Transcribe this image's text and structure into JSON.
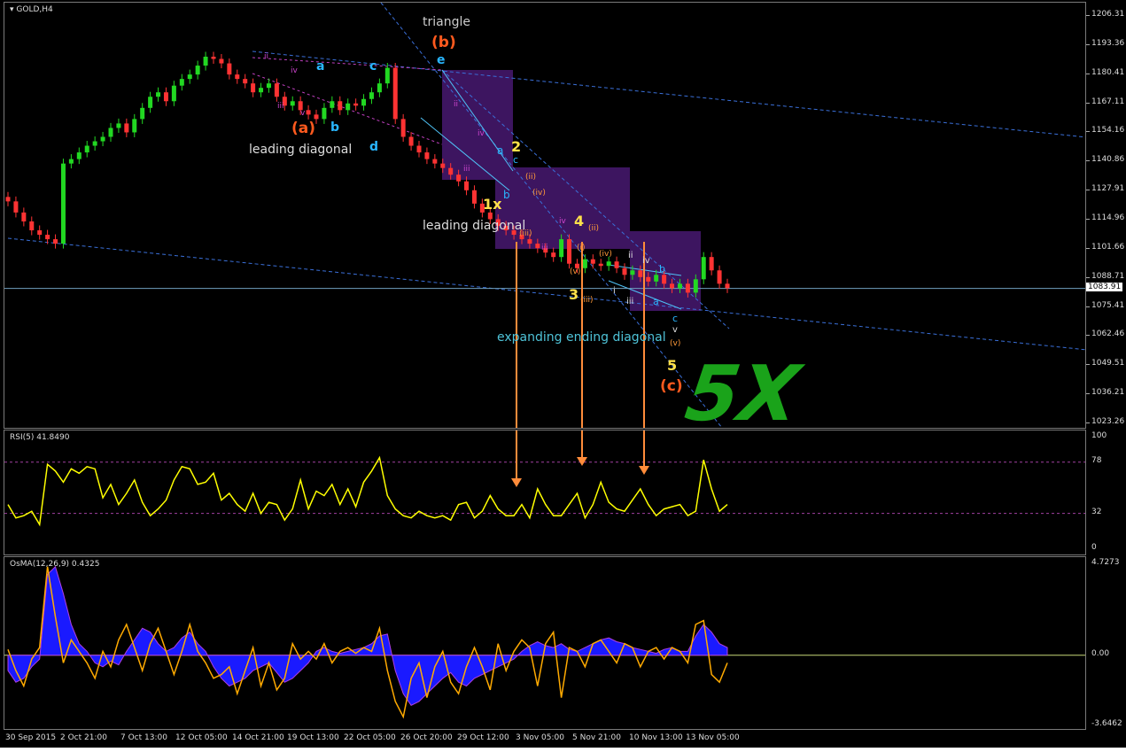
{
  "window": {
    "main_title": "GOLD,H4",
    "rsi_title": "RSI(5) 41.8490",
    "osma_title": "OsMA(12,26,9) 0.4325"
  },
  "colors": {
    "bull": "#22d822",
    "bear": "#ff3333",
    "rsi": "#ffff00",
    "osma_fill": "#1a1aff",
    "signal": "#ffaa00",
    "guide": "#3a6fd8",
    "box": "#3d1560",
    "arrow": "#ff8c3a"
  },
  "price_axis": {
    "ticks": [
      "1206.31",
      "1193.36",
      "1180.41",
      "1167.11",
      "1154.16",
      "1140.86",
      "1127.91",
      "1114.96",
      "1101.66",
      "1088.71",
      "1075.41",
      "1062.46",
      "1049.51",
      "1036.21",
      "1023.26"
    ],
    "current": "1083.91"
  },
  "rsi_axis": {
    "ticks": [
      "100",
      "78",
      "32",
      "0"
    ]
  },
  "osma_axis": {
    "ticks": [
      "4.7273",
      "0.00",
      "-3.6462"
    ]
  },
  "time_axis": [
    "30 Sep 2015",
    "2 Oct 21:00",
    "7 Oct 13:00",
    "12 Oct 05:00",
    "14 Oct 21:00",
    "19 Oct 13:00",
    "22 Oct 05:00",
    "26 Oct 20:00",
    "29 Oct 12:00",
    "3 Nov 05:00",
    "5 Nov 21:00",
    "10 Nov 13:00",
    "13 Nov 05:00"
  ],
  "annotations": {
    "triangle": "triangle",
    "b_wave": "(b)",
    "e": "e",
    "a_wave": "(a)",
    "c_wave": "(c)",
    "leading_diag_1": "leading diagonal",
    "leading_diag_2": "leading diagonal",
    "expanding_diag": "expanding ending diagonal",
    "a": "a",
    "b": "b",
    "c": "c",
    "d": "d",
    "w1x": "1x",
    "w2": "2",
    "w3": "3",
    "w4": "4",
    "w5": "5",
    "big_5x": "5X",
    "small": {
      "ii": "ii",
      "iv": "iv",
      "i": "i",
      "iii": "iii",
      "v": "v",
      "p_ii": "(ii)",
      "p_iii": "(iii)",
      "p_iv": "(iv)",
      "p_v": "(v)",
      "p_i": "(i)"
    }
  },
  "chart_data": [
    {
      "type": "candlestick",
      "title": "GOLD,H4",
      "ylim": [
        1023.26,
        1206.31
      ],
      "x": [
        "30 Sep 2015",
        "2 Oct 21:00",
        "7 Oct 13:00",
        "12 Oct 05:00",
        "14 Oct 21:00",
        "19 Oct 13:00",
        "22 Oct 05:00",
        "26 Oct 20:00",
        "29 Oct 12:00",
        "3 Nov 05:00",
        "5 Nov 21:00",
        "10 Nov 13:00",
        "13 Nov 05:00"
      ],
      "close_path": [
        1123,
        1118,
        1114,
        1110,
        1108,
        1106,
        1104,
        1140,
        1142,
        1145,
        1148,
        1150,
        1152,
        1156,
        1158,
        1154,
        1160,
        1165,
        1170,
        1172,
        1168,
        1175,
        1178,
        1180,
        1184,
        1188,
        1187,
        1185,
        1180,
        1178,
        1176,
        1172,
        1174,
        1176,
        1170,
        1166,
        1168,
        1164,
        1162,
        1160,
        1165,
        1168,
        1164,
        1167,
        1166,
        1169,
        1172,
        1176,
        1183,
        1160,
        1152,
        1148,
        1145,
        1142,
        1140,
        1138,
        1135,
        1132,
        1128,
        1122,
        1118,
        1115,
        1112,
        1110,
        1108,
        1106,
        1104,
        1102,
        1100,
        1098,
        1106,
        1095,
        1093,
        1097,
        1095,
        1094,
        1096,
        1093,
        1090,
        1092,
        1089,
        1087,
        1090,
        1086,
        1084,
        1086,
        1082,
        1088,
        1098,
        1092,
        1086,
        1084
      ],
      "current_price": 1083.91
    },
    {
      "type": "line",
      "title": "RSI(5) 41.8490",
      "ylim": [
        0,
        100
      ],
      "series": [
        {
          "values": [
            40,
            28,
            30,
            34,
            22,
            76,
            70,
            60,
            72,
            68,
            74,
            72,
            46,
            58,
            40,
            50,
            62,
            42,
            30,
            36,
            44,
            62,
            74,
            72,
            58,
            60,
            68,
            44,
            50,
            40,
            34,
            50,
            32,
            42,
            40,
            26,
            36,
            62,
            36,
            52,
            48,
            58,
            40,
            54,
            38,
            60,
            70,
            82,
            48,
            36,
            30,
            28,
            34,
            30,
            28,
            30,
            26,
            40,
            42,
            28,
            34,
            48,
            36,
            30,
            30,
            40,
            28,
            54,
            40,
            30,
            30,
            40,
            50,
            28,
            40,
            60,
            42,
            36,
            34,
            44,
            54,
            40,
            30,
            36,
            38,
            40,
            30,
            34,
            80,
            54,
            34,
            40
          ]
        }
      ]
    },
    {
      "type": "area",
      "title": "OsMA(12,26,9) 0.4325",
      "ylim": [
        -3.6462,
        4.7273
      ],
      "series": [
        {
          "values": [
            -0.8,
            -1.4,
            -1.2,
            -0.6,
            -0.2,
            4.2,
            4.6,
            3.2,
            1.6,
            0.6,
            0.2,
            -0.4,
            -0.6,
            -0.3,
            -0.5,
            0.2,
            0.8,
            1.4,
            1.2,
            0.6,
            0.2,
            0.4,
            0.9,
            1.2,
            0.6,
            0.2,
            -0.6,
            -1.2,
            -1.6,
            -1.4,
            -1.2,
            -0.8,
            -0.6,
            -0.4,
            -0.9,
            -1.4,
            -1.2,
            -0.8,
            -0.4,
            0.2,
            0.4,
            0.2,
            0.1,
            0.2,
            0.3,
            0.4,
            0.6,
            1.0,
            1.1,
            -0.8,
            -2.0,
            -2.6,
            -2.4,
            -2.0,
            -1.6,
            -1.2,
            -0.9,
            -1.4,
            -1.6,
            -1.2,
            -1.0,
            -0.8,
            -0.6,
            -0.4,
            -0.2,
            0.2,
            0.5,
            0.7,
            0.5,
            0.4,
            0.6,
            0.3,
            0.2,
            0.4,
            0.6,
            0.8,
            0.9,
            0.7,
            0.6,
            0.4,
            0.3,
            0.2,
            0.1,
            0.3,
            0.4,
            0.2,
            0.2,
            1.0,
            1.6,
            1.2,
            0.6,
            0.4
          ]
        },
        {
          "values": [
            0.3,
            -0.8,
            -1.6,
            -0.2,
            0.4,
            4.6,
            2.0,
            -0.4,
            0.8,
            0.2,
            -0.4,
            -1.2,
            0.2,
            -0.6,
            0.8,
            1.6,
            0.4,
            -0.8,
            0.6,
            1.4,
            0.2,
            -1.0,
            0.2,
            1.6,
            0.2,
            -0.4,
            -1.2,
            -1.0,
            -0.6,
            -2.0,
            -0.8,
            0.4,
            -1.6,
            -0.4,
            -1.8,
            -1.2,
            0.6,
            -0.2,
            0.2,
            -0.2,
            0.6,
            -0.4,
            0.2,
            0.4,
            0.1,
            0.4,
            0.2,
            1.4,
            -0.8,
            -2.4,
            -3.2,
            -1.2,
            -0.4,
            -2.2,
            -0.6,
            0.2,
            -1.4,
            -2.0,
            -0.6,
            0.4,
            -0.6,
            -1.8,
            0.6,
            -0.8,
            0.2,
            0.8,
            0.4,
            -1.6,
            0.6,
            1.2,
            -2.2,
            0.4,
            0.2,
            -0.6,
            0.6,
            0.8,
            0.2,
            -0.4,
            0.6,
            0.4,
            -0.6,
            0.2,
            0.4,
            -0.2,
            0.4,
            0.2,
            -0.4,
            1.6,
            1.8,
            -1.0,
            -1.4,
            -0.4
          ]
        }
      ]
    }
  ]
}
